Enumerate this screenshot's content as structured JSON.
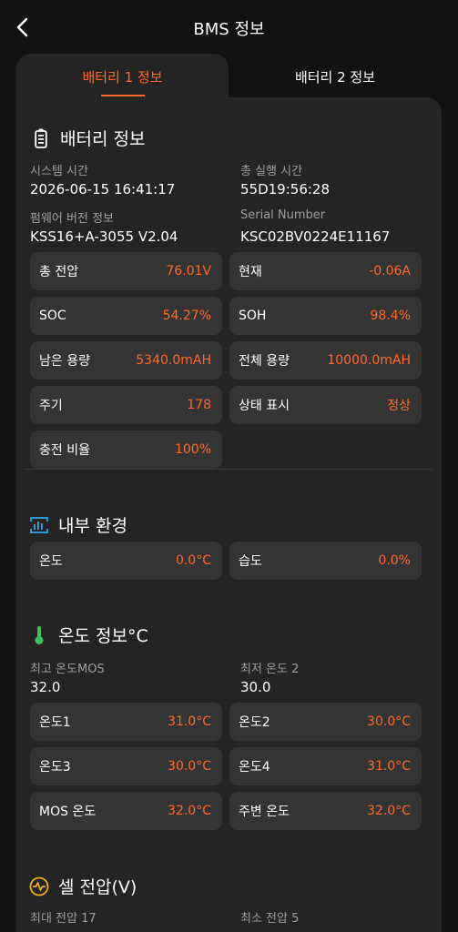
{
  "header": {
    "title": "BMS 정보"
  },
  "tabs": [
    {
      "label": "배터리 1 정보"
    },
    {
      "label": "배터리 2 정보"
    }
  ],
  "battery_info": {
    "title": "배터리 정보",
    "system_time_label": "시스템 시간",
    "system_time": "2026-06-15 16:41:17",
    "total_runtime_label": "총 실행 시간",
    "total_runtime": "55D19:56:28",
    "firmware_label": "펌웨어 버전 정보",
    "firmware": "KSS16+A-3055 V2.04",
    "serial_label": "Serial Number",
    "serial": "KSC02BV0224E11167",
    "cards": [
      {
        "label": "총 전압",
        "value": "76.01V"
      },
      {
        "label": "현재",
        "value": "-0.06A"
      },
      {
        "label": "SOC",
        "value": "54.27%"
      },
      {
        "label": "SOH",
        "value": "98.4%"
      },
      {
        "label": "남은 용량",
        "value": "5340.0mAH"
      },
      {
        "label": "전체 용량",
        "value": "10000.0mAH"
      },
      {
        "label": "주기",
        "value": "178"
      },
      {
        "label": "상태 표시",
        "value": "정상"
      },
      {
        "label": "충전 비율",
        "value": "100%"
      }
    ]
  },
  "internal_env": {
    "title": "내부 환경",
    "cards": [
      {
        "label": "온도",
        "value": "0.0°C"
      },
      {
        "label": "습도",
        "value": "0.0%"
      }
    ]
  },
  "temp_info": {
    "title": "온도 정보°C",
    "max_label": "최고 온도MOS",
    "max_value": "32.0",
    "min_label": "최저 온도 2",
    "min_value": "30.0",
    "cards": [
      {
        "label": "온도1",
        "value": "31.0°C"
      },
      {
        "label": "온도2",
        "value": "30.0°C"
      },
      {
        "label": "온도3",
        "value": "30.0°C"
      },
      {
        "label": "온도4",
        "value": "31.0°C"
      },
      {
        "label": "MOS 온도",
        "value": "32.0°C"
      },
      {
        "label": "주변 온도",
        "value": "32.0°C"
      }
    ]
  },
  "cell_voltage": {
    "title": "셀 전압(V)",
    "max_label": "최대 전압 17",
    "min_label": "최소 전압 5"
  },
  "colors": {
    "accent": "#ff6a2b",
    "background": "#121212",
    "panel": "#242424",
    "card": "#343434",
    "label": "#9e9e9e"
  }
}
